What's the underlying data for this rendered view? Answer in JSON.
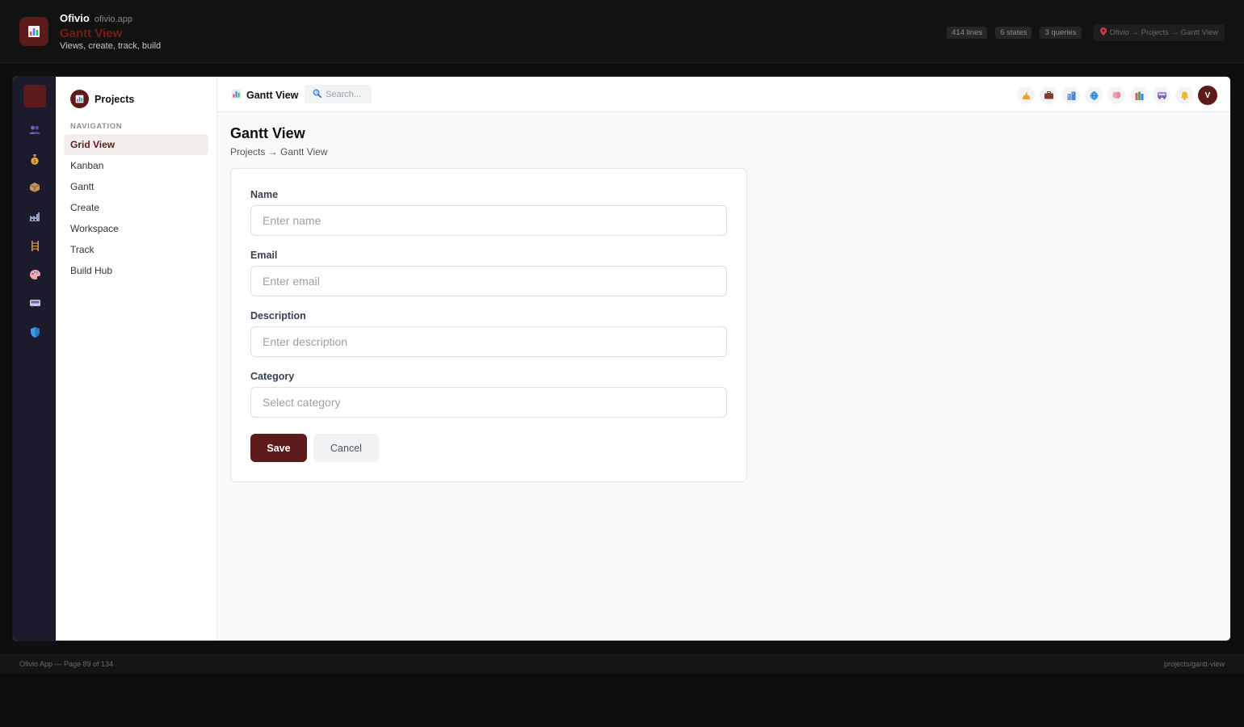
{
  "banner": {
    "app_name": "Ofivio",
    "domain": "ofivio.app",
    "page_title": "Gantt View",
    "tagline": "Views, create, track, build",
    "logo_icon": "bar-chart-icon",
    "stats": [
      "414 lines",
      "6 states",
      "3 queries"
    ],
    "location": "Ofivio → Projects → Gantt View"
  },
  "rail": {
    "icons": [
      "users-icon",
      "money-bag-icon",
      "package-icon",
      "factory-icon",
      "ladder-icon",
      "palette-icon",
      "bus-icon",
      "shield-icon"
    ]
  },
  "sidebar": {
    "title": "Projects",
    "section_label": "NAVIGATION",
    "items": [
      {
        "label": "Grid View",
        "active": true
      },
      {
        "label": "Kanban",
        "active": false
      },
      {
        "label": "Gantt",
        "active": false
      },
      {
        "label": "Create",
        "active": false
      },
      {
        "label": "Workspace",
        "active": false
      },
      {
        "label": "Track",
        "active": false
      },
      {
        "label": "Build Hub",
        "active": false
      }
    ]
  },
  "topbar": {
    "title": "Gantt View",
    "search_placeholder": "Search...",
    "icons": [
      "muscle-icon",
      "briefcase-icon",
      "buildings-icon",
      "globe-icon",
      "brain-icon",
      "books-icon",
      "bus-icon",
      "bell-icon"
    ],
    "user_initial": "V"
  },
  "main": {
    "page_title": "Gantt View",
    "breadcrumb": "Projects → Gantt View"
  },
  "form": {
    "fields": [
      {
        "label": "Name",
        "placeholder": "Enter name"
      },
      {
        "label": "Email",
        "placeholder": "Enter email"
      },
      {
        "label": "Description",
        "placeholder": "Enter description"
      },
      {
        "label": "Category",
        "placeholder": "Select category"
      }
    ],
    "save_label": "Save",
    "cancel_label": "Cancel"
  },
  "footer": {
    "left": "Ofivio App — Page 89 of 134",
    "right": "projects/gantt-view"
  },
  "colors": {
    "accent": "#5c1a1a",
    "banner_title": "#7a1c1c",
    "rail_bg": "#1c1b2e",
    "page_bg": "#0e0e0e"
  }
}
